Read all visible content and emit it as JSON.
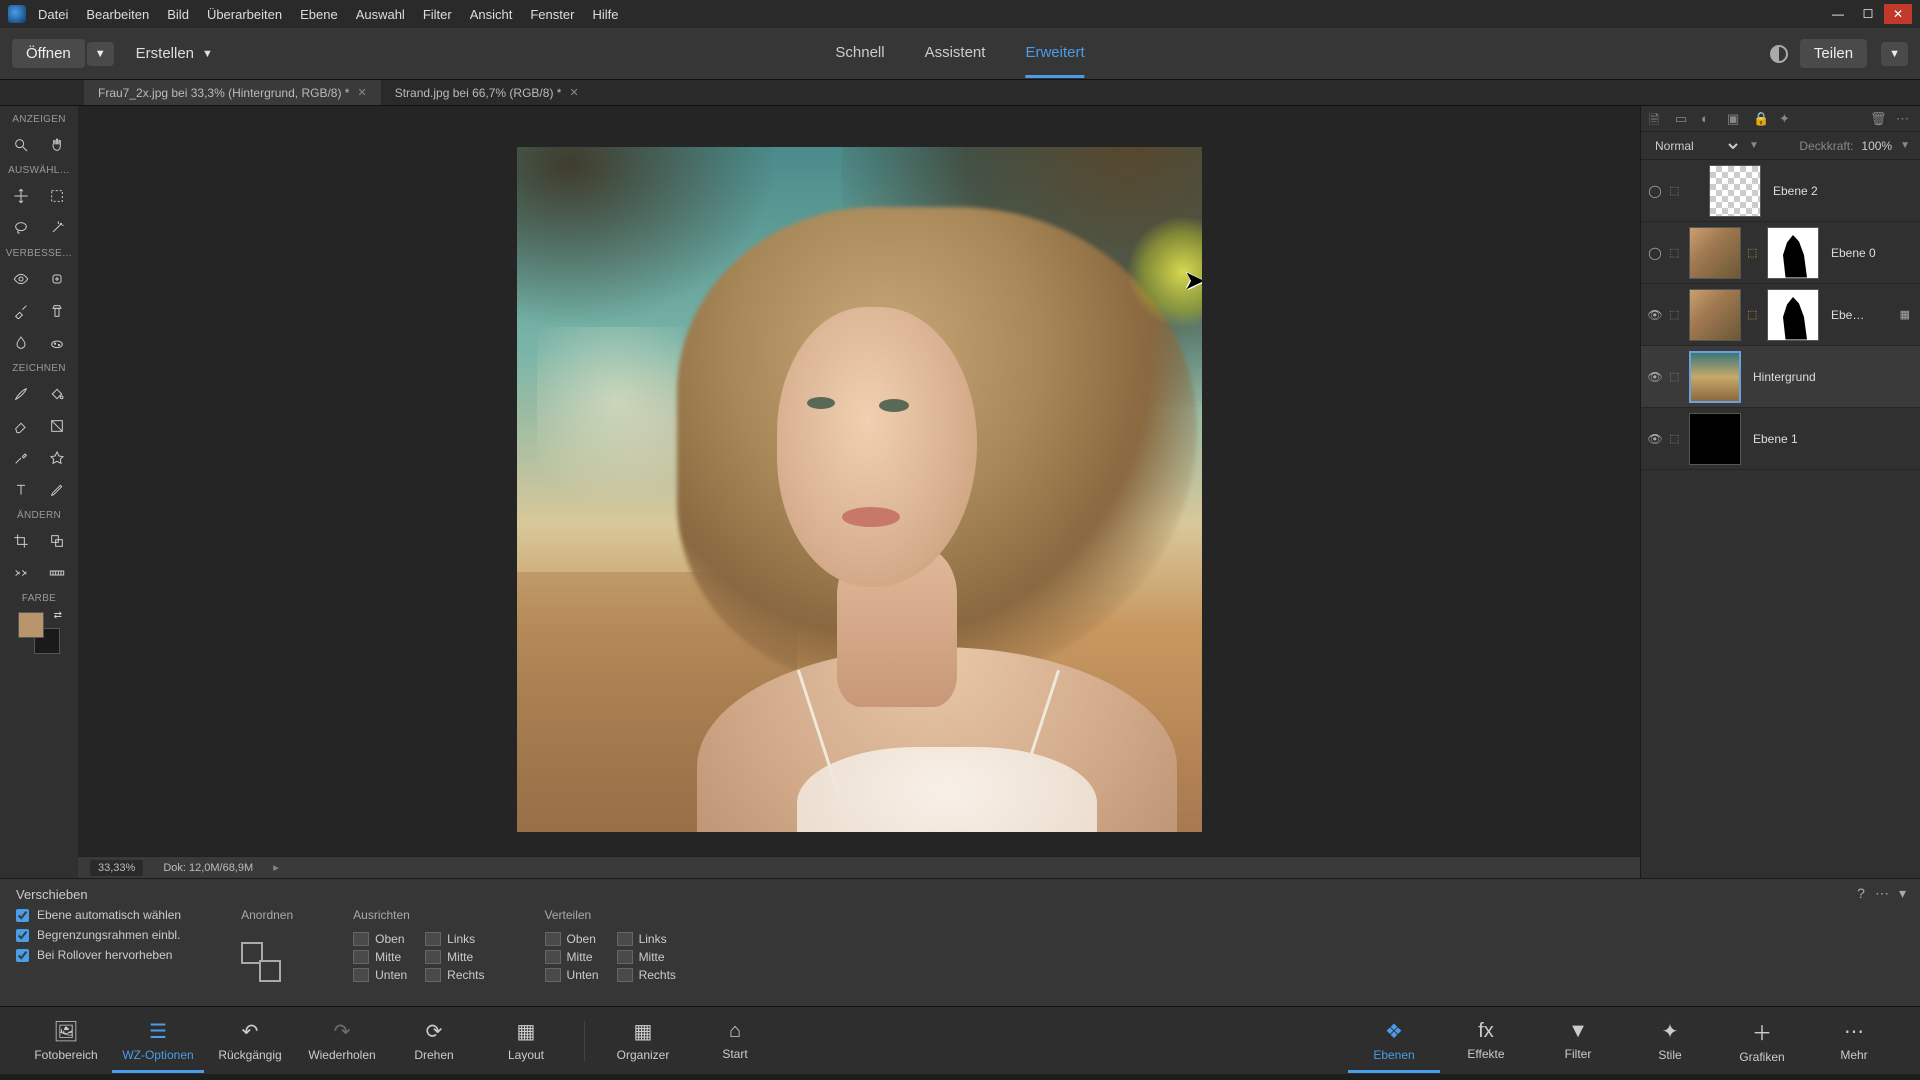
{
  "menu": {
    "items": [
      "Datei",
      "Bearbeiten",
      "Bild",
      "Überarbeiten",
      "Ebene",
      "Auswahl",
      "Filter",
      "Ansicht",
      "Fenster",
      "Hilfe"
    ]
  },
  "toolbar": {
    "open": "Öffnen",
    "create": "Erstellen",
    "modes": {
      "quick": "Schnell",
      "guided": "Assistent",
      "expert": "Erweitert"
    },
    "share": "Teilen"
  },
  "doctabs": [
    {
      "label": "Frau7_2x.jpg bei 33,3% (Hintergrund, RGB/8) *",
      "active": true
    },
    {
      "label": "Strand.jpg bei 66,7% (RGB/8) *",
      "active": false
    }
  ],
  "toolbox": {
    "sections": {
      "view": "ANZEIGEN",
      "select": "AUSWÄHL…",
      "enhance": "VERBESSE…",
      "draw": "ZEICHNEN",
      "modify": "ÄNDERN",
      "color": "FARBE"
    }
  },
  "status": {
    "zoom": "33,33%",
    "doc": "Dok: 12,0M/68,9M"
  },
  "right_panel": {
    "blend_mode": "Normal",
    "opacity_label": "Deckkraft:",
    "opacity_value": "100%",
    "layers": [
      {
        "name": "Ebene 2",
        "visible": false,
        "type": "checker",
        "mask": false
      },
      {
        "name": "Ebene 0",
        "visible": false,
        "type": "portrait",
        "mask": true,
        "link": true
      },
      {
        "name": "Ebe…",
        "visible": true,
        "type": "portrait",
        "mask": true,
        "link": true,
        "fx": true
      },
      {
        "name": "Hintergrund",
        "visible": true,
        "type": "beach",
        "mask": false,
        "selected": true
      },
      {
        "name": "Ebene 1",
        "visible": true,
        "type": "black",
        "mask": false
      }
    ]
  },
  "options": {
    "title": "Verschieben",
    "checks": [
      "Ebene automatisch wählen",
      "Begrenzungsrahmen einbl.",
      "Bei Rollover hervorheben"
    ],
    "arrange": "Anordnen",
    "align": {
      "title": "Ausrichten",
      "col1": [
        "Oben",
        "Mitte",
        "Unten"
      ],
      "col2": [
        "Links",
        "Mitte",
        "Rechts"
      ]
    },
    "distribute": {
      "title": "Verteilen",
      "col1": [
        "Oben",
        "Mitte",
        "Unten"
      ],
      "col2": [
        "Links",
        "Mitte",
        "Rechts"
      ]
    }
  },
  "bottom_bar": {
    "left": [
      {
        "label": "Fotobereich"
      },
      {
        "label": "WZ-Optionen",
        "active": true
      },
      {
        "label": "Rückgängig"
      },
      {
        "label": "Wiederholen"
      },
      {
        "label": "Drehen"
      },
      {
        "label": "Layout"
      }
    ],
    "mid": [
      {
        "label": "Organizer"
      },
      {
        "label": "Start"
      }
    ],
    "right": [
      {
        "label": "Ebenen",
        "active": true
      },
      {
        "label": "Effekte"
      },
      {
        "label": "Filter"
      },
      {
        "label": "Stile"
      },
      {
        "label": "Grafiken"
      },
      {
        "label": "Mehr"
      }
    ]
  }
}
